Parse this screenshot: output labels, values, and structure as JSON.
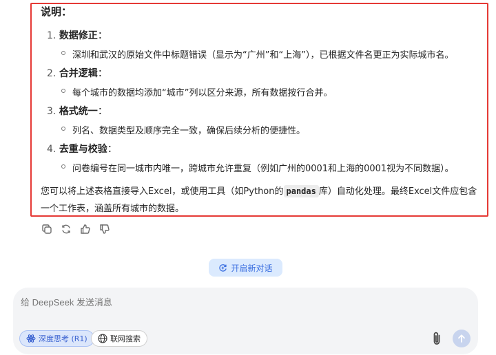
{
  "message": {
    "section_title": "说明：",
    "items": [
      {
        "number": "1.",
        "label": "数据修正",
        "colon": "：",
        "detail": "深圳和武汉的原始文件中标题错误（显示为“广州”和“上海”），已根据文件名更正为实际城市名。"
      },
      {
        "number": "2.",
        "label": "合并逻辑",
        "colon": "：",
        "detail": "每个城市的数据均添加“城市”列以区分来源，所有数据按行合并。"
      },
      {
        "number": "3.",
        "label": "格式统一",
        "colon": "：",
        "detail": "列名、数据类型及顺序完全一致，确保后续分析的便捷性。"
      },
      {
        "number": "4.",
        "label": "去重与校验",
        "colon": "：",
        "detail": "问卷编号在同一城市内唯一，跨城市允许重复（例如广州的0001和上海的0001视为不同数据）。"
      }
    ],
    "closing_before": "您可以将上述表格直接导入Excel，或使用工具（如Python的",
    "closing_code": "pandas",
    "closing_after": "库）自动化处理。最终Excel文件应包含一个工作表，涵盖所有城市的数据。"
  },
  "actions": {
    "icons": [
      "copy-icon",
      "regenerate-icon",
      "thumbs-up-icon",
      "thumbs-down-icon"
    ]
  },
  "new_chat": {
    "label": "开启新对话"
  },
  "composer": {
    "placeholder": "给 DeepSeek 发送消息",
    "deep_think_label": "深度思考 (R1)",
    "web_search_label": "联网搜索"
  },
  "colors": {
    "highlight_border": "#e53935",
    "accent": "#3b6fe0",
    "send_disabled": "#c8d4ee"
  }
}
